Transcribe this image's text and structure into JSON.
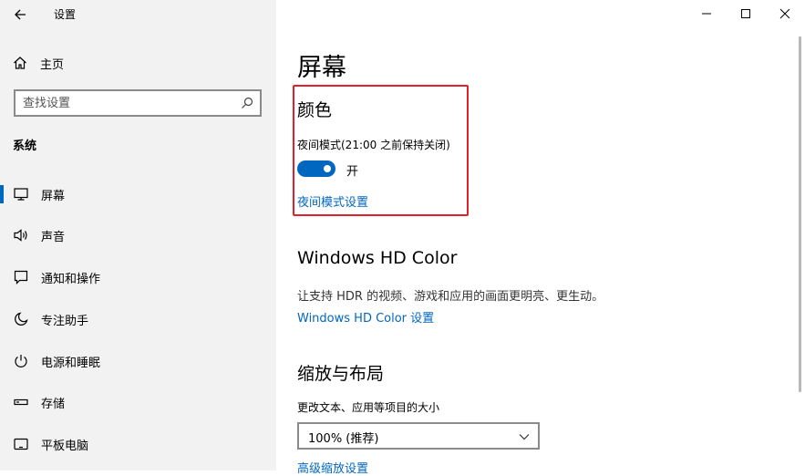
{
  "app": {
    "title": "设置"
  },
  "sidebar": {
    "home_label": "主页",
    "search_placeholder": "查找设置",
    "section_label": "系统",
    "items": [
      {
        "label": "屏幕",
        "icon": "monitor-icon"
      },
      {
        "label": "声音",
        "icon": "speaker-icon"
      },
      {
        "label": "通知和操作",
        "icon": "notification-icon"
      },
      {
        "label": "专注助手",
        "icon": "moon-icon"
      },
      {
        "label": "电源和睡眠",
        "icon": "power-icon"
      },
      {
        "label": "存储",
        "icon": "storage-icon"
      },
      {
        "label": "平板电脑",
        "icon": "tablet-icon"
      }
    ],
    "active_index": 0
  },
  "main": {
    "page_title": "屏幕",
    "color": {
      "heading": "颜色",
      "night_label": "夜间模式(21:00 之前保持关闭)",
      "toggle_state": "开",
      "toggle_on": true,
      "night_link": "夜间模式设置"
    },
    "hd": {
      "heading": "Windows HD Color",
      "description": "让支持 HDR 的视频、游戏和应用的画面更明亮、更生动。",
      "link": "Windows HD Color 设置"
    },
    "layout": {
      "heading": "缩放与布局",
      "scale_label": "更改文本、应用等项目的大小",
      "scale_value": "100% (推荐)",
      "advanced_link": "高级缩放设置"
    }
  },
  "colors": {
    "accent": "#0067c0",
    "highlight_border": "#e0202a",
    "sidebar_bg": "#f2f2f2"
  }
}
